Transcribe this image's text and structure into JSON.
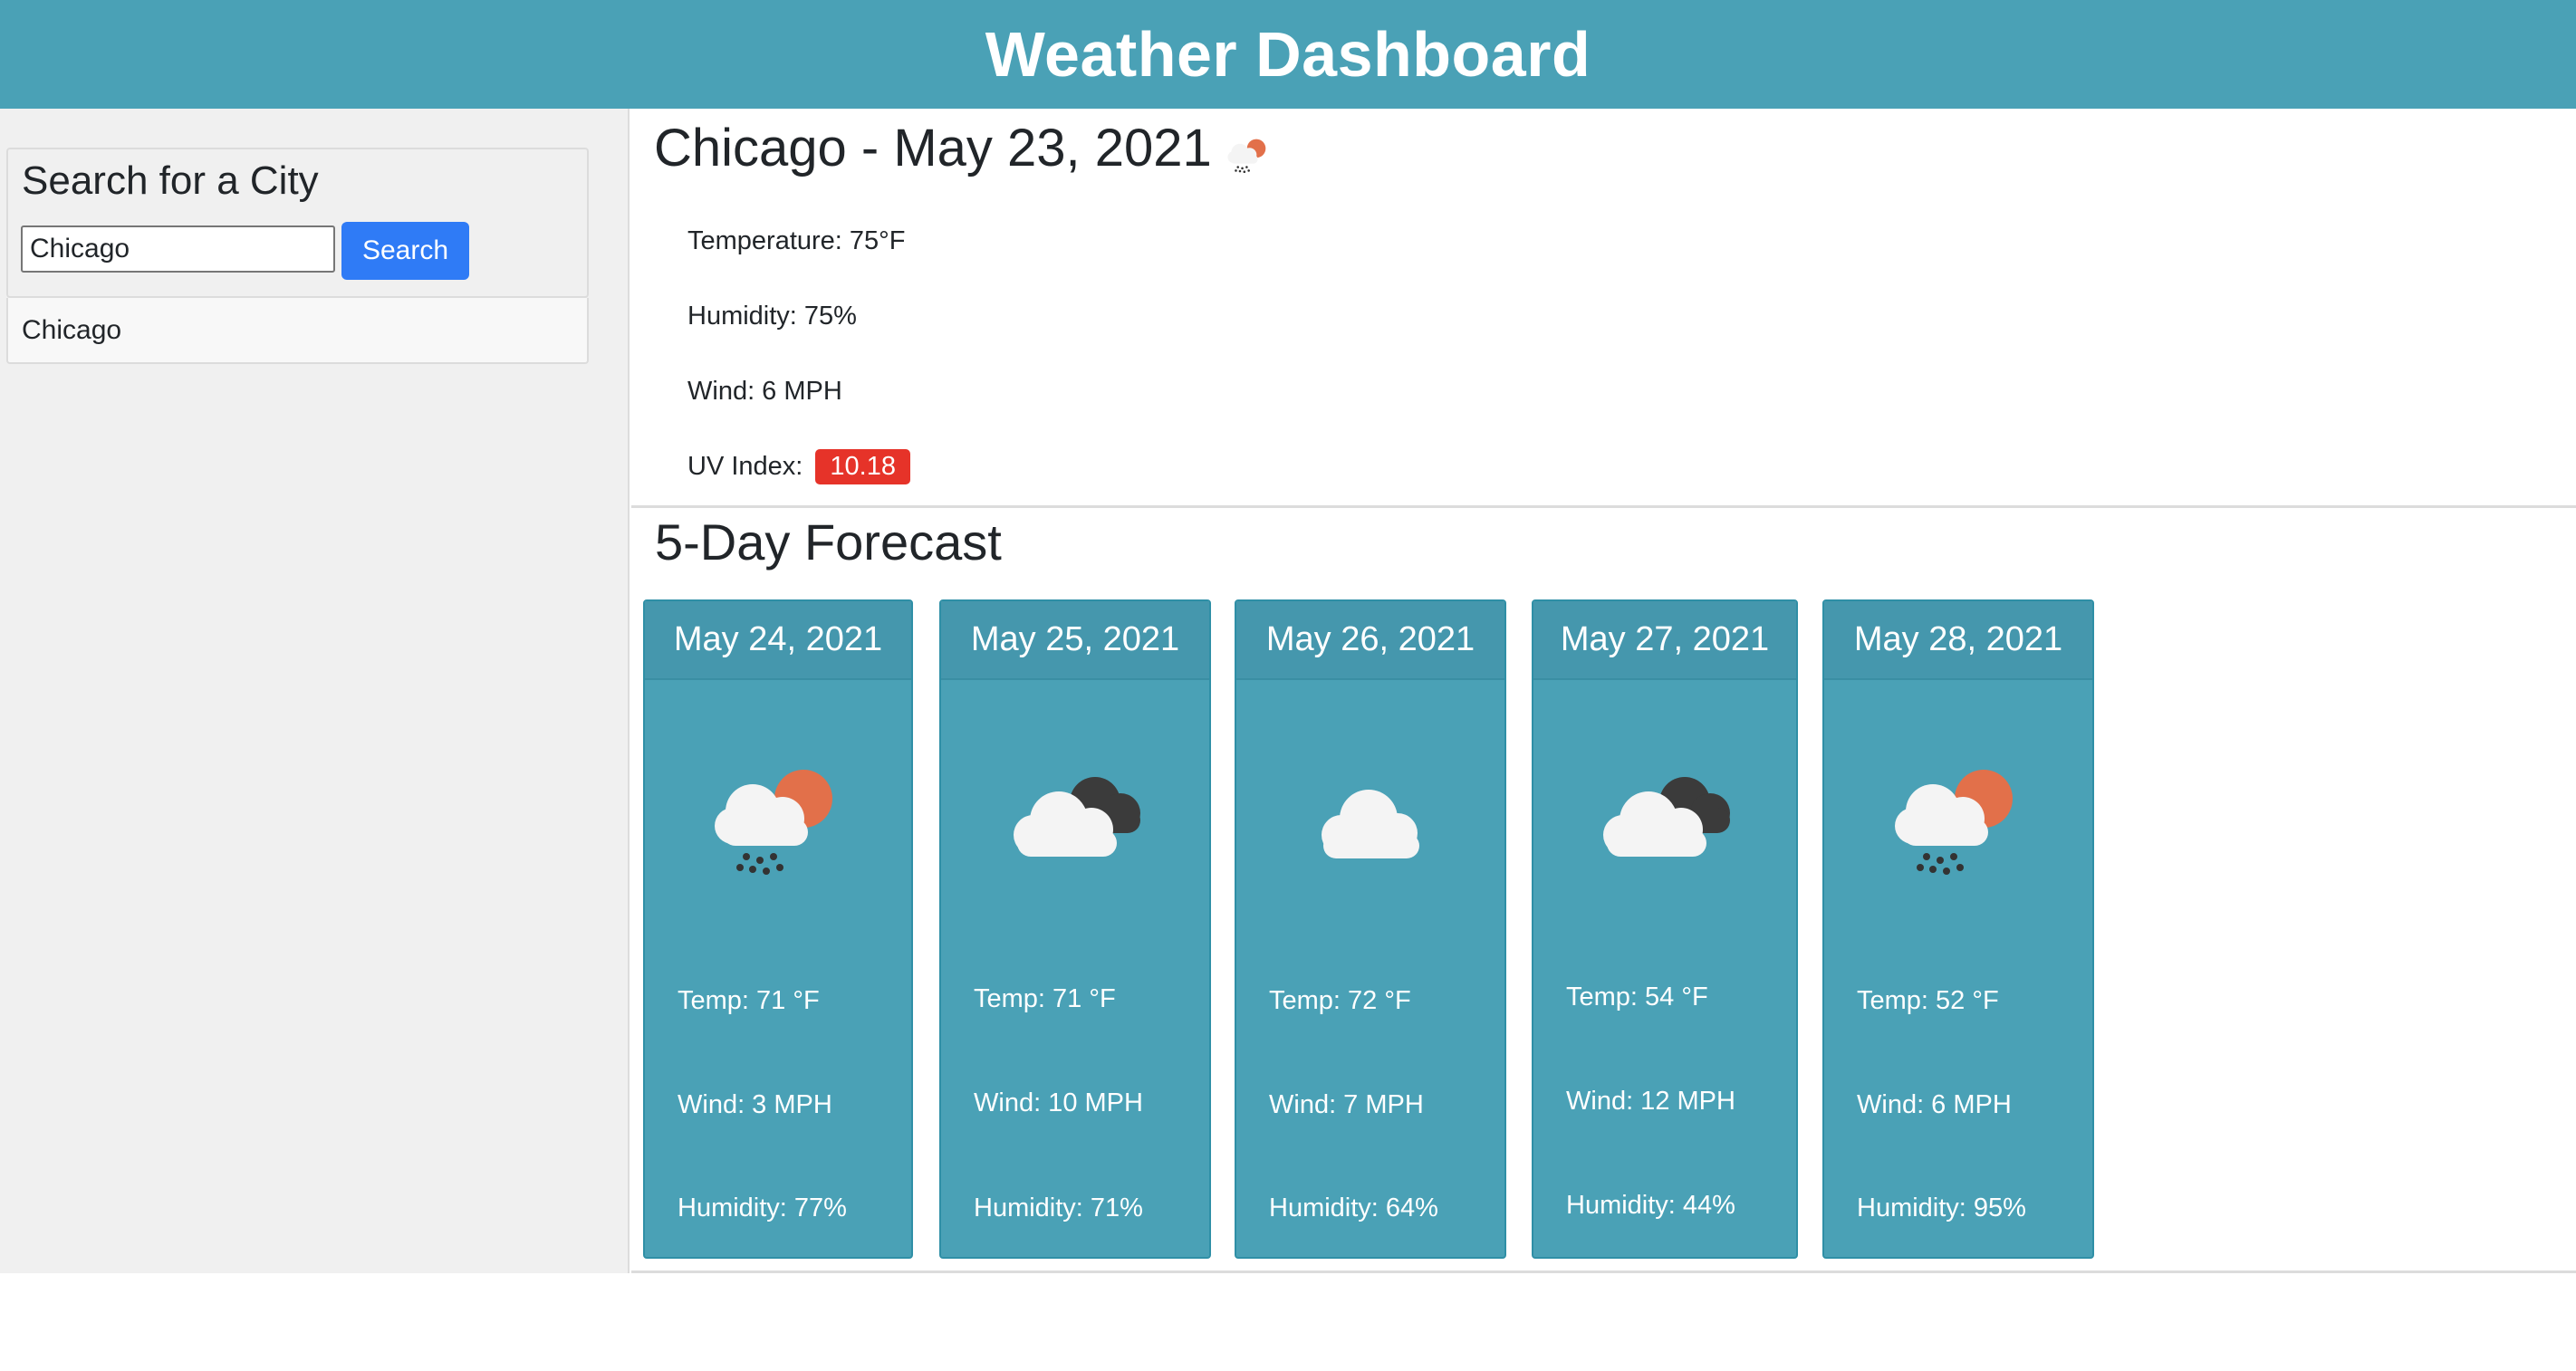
{
  "header": {
    "title": "Weather Dashboard"
  },
  "sidebar": {
    "search_title": "Search for a City",
    "search_value": "Chicago",
    "search_placeholder": "Chicago",
    "search_button": "Search",
    "history": [
      "Chicago"
    ]
  },
  "current": {
    "title": "Chicago - May 23, 2021",
    "icon": "rain-sun-icon",
    "temperature": "Temperature: 75°F",
    "humidity": "Humidity: 75%",
    "wind": "Wind: 6 MPH",
    "uv_label": "UV Index:",
    "uv_value": "10.18",
    "uv_color": "#e63329"
  },
  "forecast": {
    "title": "5-Day Forecast",
    "days": [
      {
        "date": "May 24, 2021",
        "icon": "rain-sun-icon",
        "temp": "Temp: 71 °F",
        "wind": "Wind: 3 MPH",
        "humidity": "Humidity: 77%"
      },
      {
        "date": "May 25, 2021",
        "icon": "broken-clouds-icon",
        "temp": "Temp: 71 °F",
        "wind": "Wind: 10 MPH",
        "humidity": "Humidity: 71%"
      },
      {
        "date": "May 26, 2021",
        "icon": "cloud-icon",
        "temp": "Temp: 72 °F",
        "wind": "Wind: 7 MPH",
        "humidity": "Humidity: 64%"
      },
      {
        "date": "May 27, 2021",
        "icon": "broken-clouds-icon",
        "temp": "Temp: 54 °F",
        "wind": "Wind: 12 MPH",
        "humidity": "Humidity: 44%"
      },
      {
        "date": "May 28, 2021",
        "icon": "rain-sun-icon",
        "temp": "Temp: 52 °F",
        "wind": "Wind: 6 MPH",
        "humidity": "Humidity: 95%"
      }
    ]
  },
  "colors": {
    "header_bg": "#4aa1b6",
    "card_bg": "#4aa1b6",
    "button_bg": "#2f7bf6",
    "uv_badge": "#e63329"
  }
}
